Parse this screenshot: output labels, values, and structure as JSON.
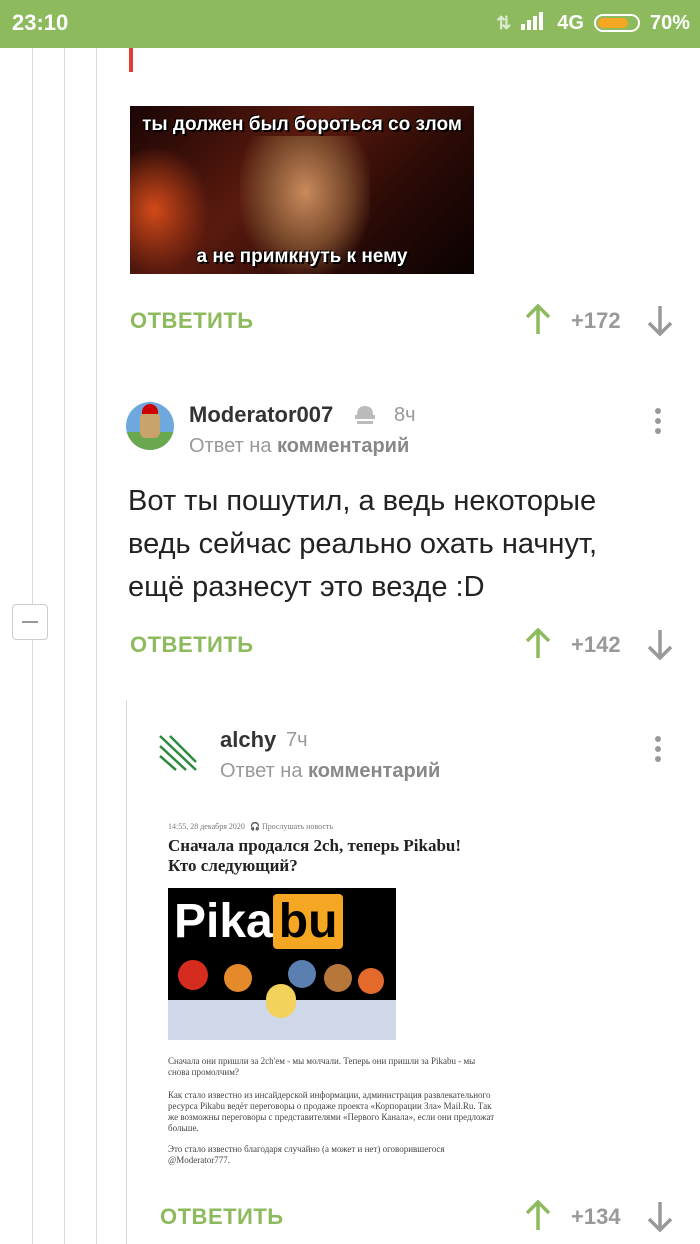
{
  "status": {
    "time": "23:10",
    "network": "4G",
    "battery": "70%",
    "battery_level": 0.7
  },
  "meme": {
    "top_text": "ты должен был бороться со злом",
    "bottom_text": "а не примкнуть к нему"
  },
  "comments": [
    {
      "reply_label": "ОТВЕТИТЬ",
      "rating": "+172"
    },
    {
      "username": "Moderator007",
      "time": "8ч",
      "meta_prefix": "Ответ на",
      "meta_link": "комментарий",
      "text": "Вот ты пошутил, а ведь некоторые ведь сейчас реально охать начнут, ещё разнесут это везде :D",
      "reply_label": "ОТВЕТИТЬ",
      "rating": "+142"
    },
    {
      "username": "alchy",
      "time": "7ч",
      "meta_prefix": "Ответ на",
      "meta_link": "комментарий",
      "reply_label": "ОТВЕТИТЬ",
      "rating": "+134"
    }
  ],
  "article": {
    "date": "14:55, 28 декабря 2020",
    "listen": "Прослушать новость",
    "title": "Сначала продался 2ch, теперь Pikabu! Кто следующий?",
    "logo_left": "Pika",
    "logo_right": "bu",
    "p1": "Сначала они пришли за 2ch'ем - мы молчали. Теперь они пришли за Pikabu - мы снова промолчим?",
    "p2": "Как стало известно из инсайдерской информации, администрация развлекательного ресурса Pikabu ведёт переговоры о продаже проекта «Корпорации Зла» Mail.Ru. Так же возможны переговоры с представителями «Первого Канала», если они предложат больше.",
    "p3": "Это стало известно благодаря случайно (а может и нет) оговорившегося @Moderator777."
  }
}
